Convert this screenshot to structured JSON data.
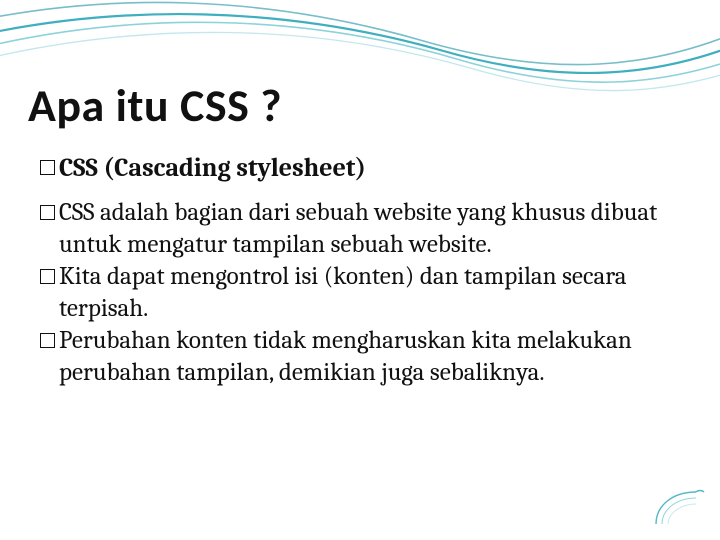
{
  "slide": {
    "title": "Apa itu CSS ?",
    "subheading": "CSS (Cascading stylesheet)",
    "points": [
      "CSS adalah bagian dari sebuah website yang khusus dibuat untuk mengatur tampilan sebuah website.",
      "Kita dapat mengontrol isi (konten) dan tampilan secara terpisah.",
      "Perubahan konten tidak mengharuskan kita melakukan perubahan tampilan, demikian juga sebaliknya."
    ]
  }
}
